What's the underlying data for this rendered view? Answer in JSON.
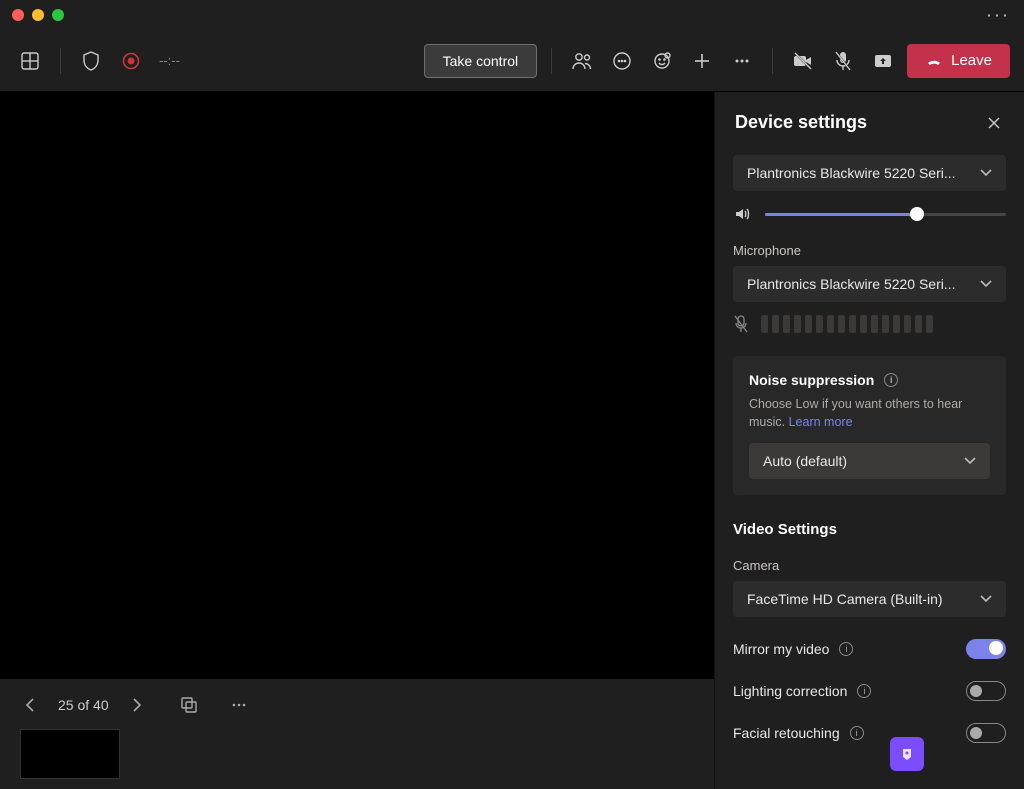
{
  "toolbar": {
    "elapsed": "--:--",
    "take_control": "Take control",
    "leave": "Leave"
  },
  "stage": {
    "slide_counter": "25 of 40"
  },
  "panel": {
    "title": "Device settings",
    "speaker_device": "Plantronics Blackwire 5220 Seri...",
    "speaker_volume_pct": 63,
    "microphone_label": "Microphone",
    "microphone_device": "Plantronics Blackwire 5220 Seri...",
    "noise": {
      "title": "Noise suppression",
      "desc": "Choose Low if you want others to hear music. ",
      "learn_more": "Learn more",
      "value": "Auto (default)"
    },
    "video": {
      "heading": "Video Settings",
      "camera_label": "Camera",
      "camera_device": "FaceTime HD Camera (Built-in)",
      "mirror": "Mirror my video",
      "lighting": "Lighting correction",
      "retouch": "Facial retouching"
    }
  }
}
